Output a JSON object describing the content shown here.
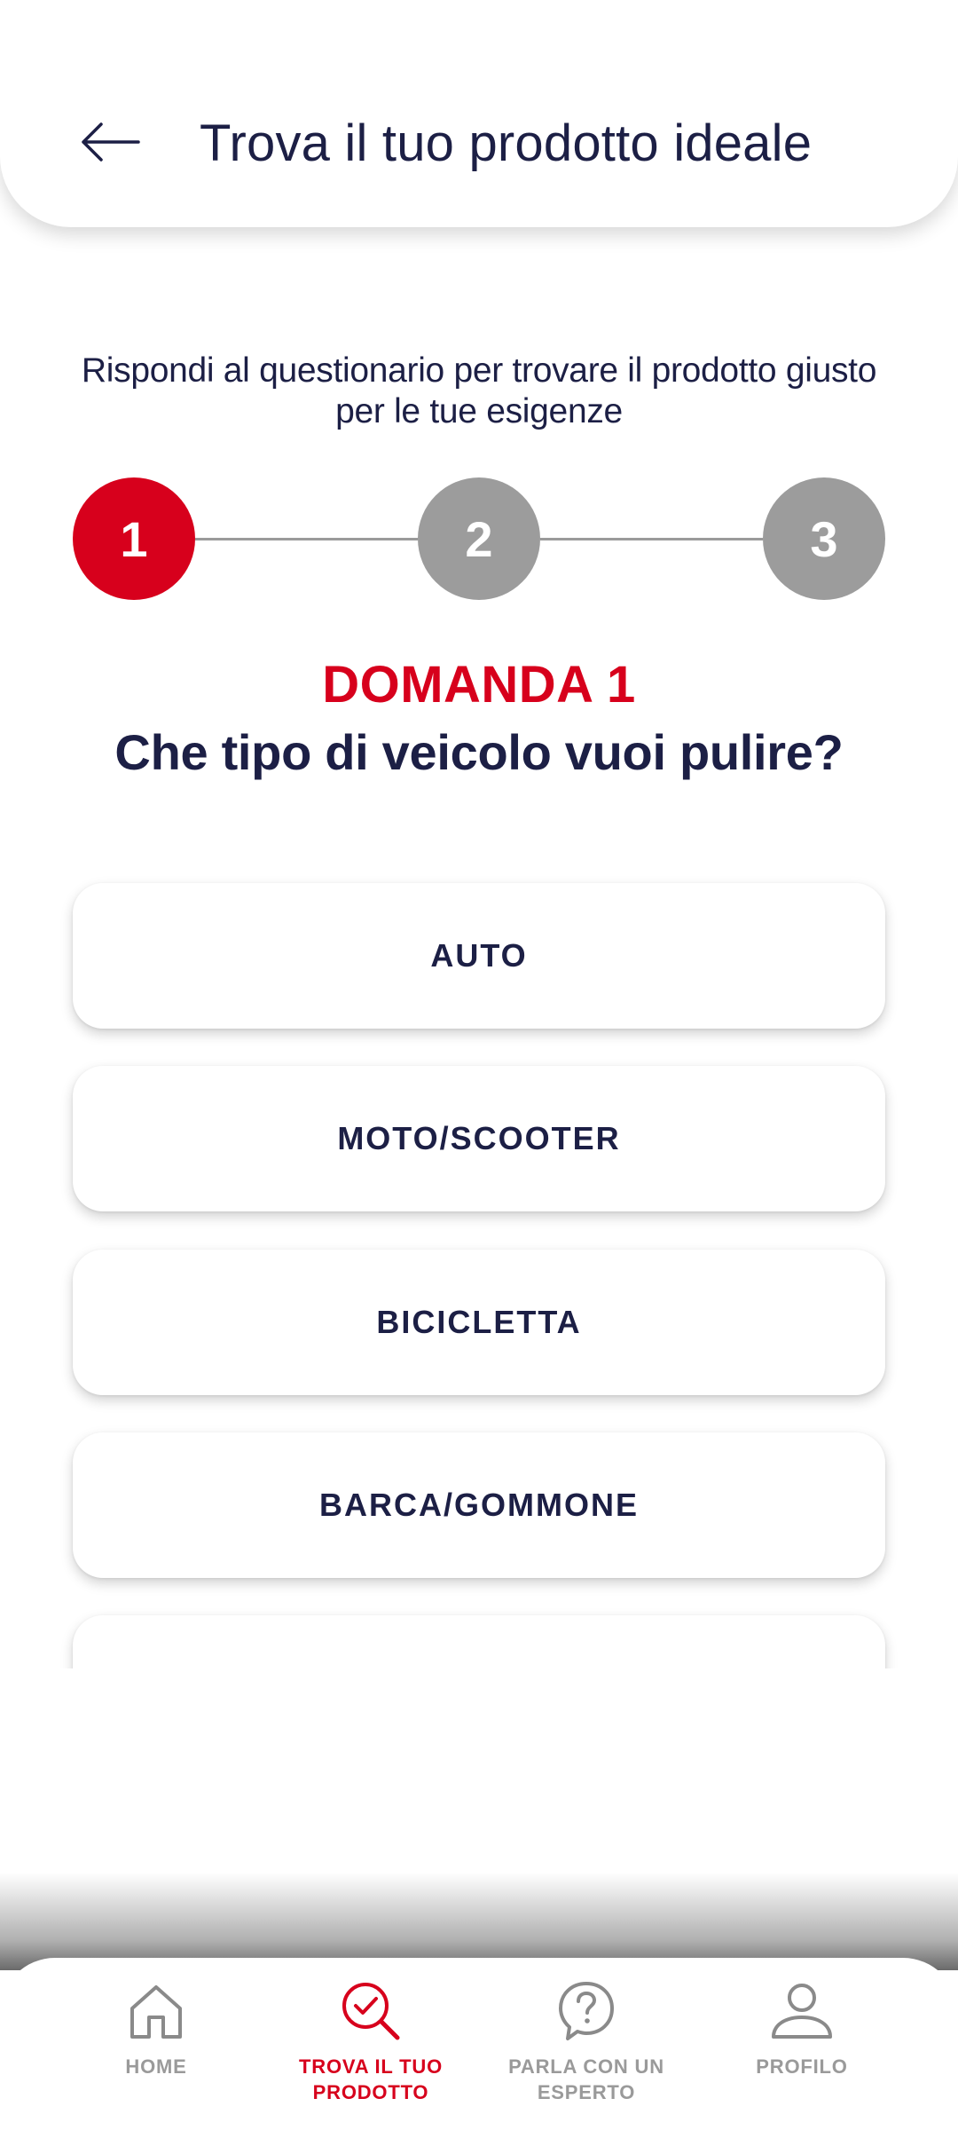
{
  "colors": {
    "accent": "#d7001c",
    "text_primary": "#1c1f45",
    "inactive": "#9c9c9c"
  },
  "header": {
    "back_icon": "arrow-left-icon",
    "title": "Trova il tuo prodotto ideale"
  },
  "intro": {
    "line1": "Rispondi al questionario per trovare il prodotto giusto",
    "line2": "per le tue esigenze"
  },
  "stepper": {
    "current_step": 1,
    "steps": [
      {
        "label": "1",
        "state": "active"
      },
      {
        "label": "2",
        "state": "inactive"
      },
      {
        "label": "3",
        "state": "inactive"
      }
    ]
  },
  "question": {
    "number_label": "DOMANDA 1",
    "text": "Che tipo di veicolo vuoi pulire?"
  },
  "options": [
    {
      "label": "AUTO"
    },
    {
      "label": "MOTO/SCOOTER"
    },
    {
      "label": "BICICLETTA"
    },
    {
      "label": "BARCA/GOMMONE"
    },
    {
      "label": ""
    }
  ],
  "bottom_nav": {
    "items": [
      {
        "icon": "home-icon",
        "label": "HOME",
        "active": false
      },
      {
        "icon": "search-check-icon",
        "label": "TROVA IL TUO PRODOTTO",
        "line1": "TROVA IL TUO",
        "line2": "PRODOTTO",
        "active": true
      },
      {
        "icon": "question-bubble-icon",
        "label": "PARLA CON UN ESPERTO",
        "line1": "PARLA CON UN",
        "line2": "ESPERTO",
        "active": false
      },
      {
        "icon": "user-icon",
        "label": "PROFILO",
        "active": false
      }
    ]
  }
}
